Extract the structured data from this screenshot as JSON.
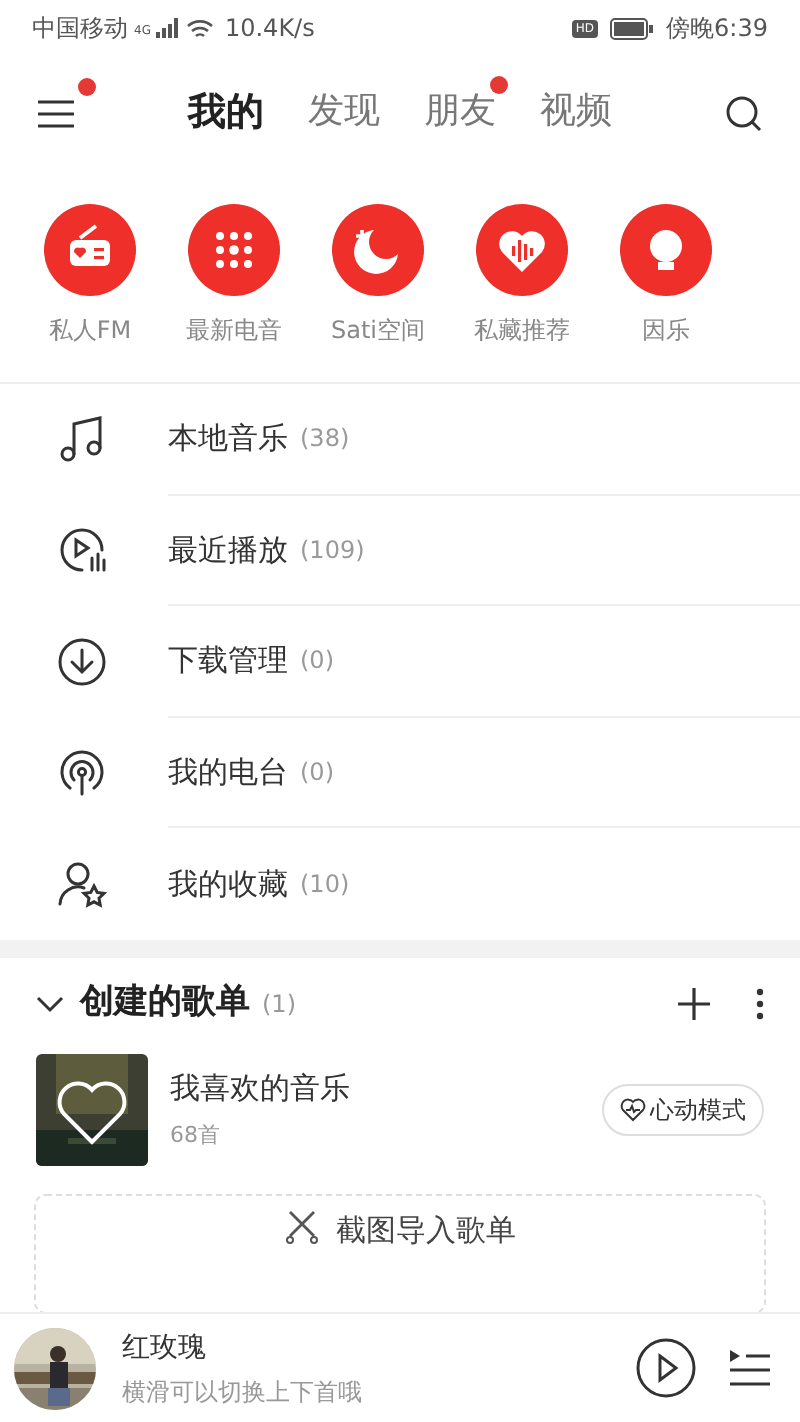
{
  "status_bar": {
    "carrier": "中国移动",
    "network": "4G",
    "speed": "10.4K/s",
    "hd": "HD",
    "time": "傍晚6:39"
  },
  "header": {
    "menu_badge": true,
    "tabs": [
      {
        "label": "我的",
        "selected": true,
        "badge": false
      },
      {
        "label": "发现",
        "selected": false,
        "badge": false
      },
      {
        "label": "朋友",
        "selected": false,
        "badge": true
      },
      {
        "label": "视频",
        "selected": false,
        "badge": false
      }
    ]
  },
  "shortcuts": [
    {
      "kind": "radio",
      "label": "私人FM"
    },
    {
      "kind": "dots",
      "label": "最新电音"
    },
    {
      "kind": "moon",
      "label": "Sati空间"
    },
    {
      "kind": "heart",
      "label": "私藏推荐"
    },
    {
      "kind": "bulb",
      "label": "因乐"
    }
  ],
  "library": [
    {
      "kind": "music",
      "label": "本地音乐",
      "count": "(38)"
    },
    {
      "kind": "recent",
      "label": "最近播放",
      "count": "(109)"
    },
    {
      "kind": "download",
      "label": "下载管理",
      "count": "(0)"
    },
    {
      "kind": "radio",
      "label": "我的电台",
      "count": "(0)"
    },
    {
      "kind": "favorite",
      "label": "我的收藏",
      "count": "(10)"
    }
  ],
  "created_playlists": {
    "title": "创建的歌单",
    "count": "(1)",
    "expanded": true,
    "items": [
      {
        "name": "我喜欢的音乐",
        "tracks": "68首",
        "button": "心动模式"
      }
    ],
    "import_button": "截图导入歌单"
  },
  "player": {
    "title": "红玫瑰",
    "subtitle": "横滑可以切换上下首哦"
  }
}
